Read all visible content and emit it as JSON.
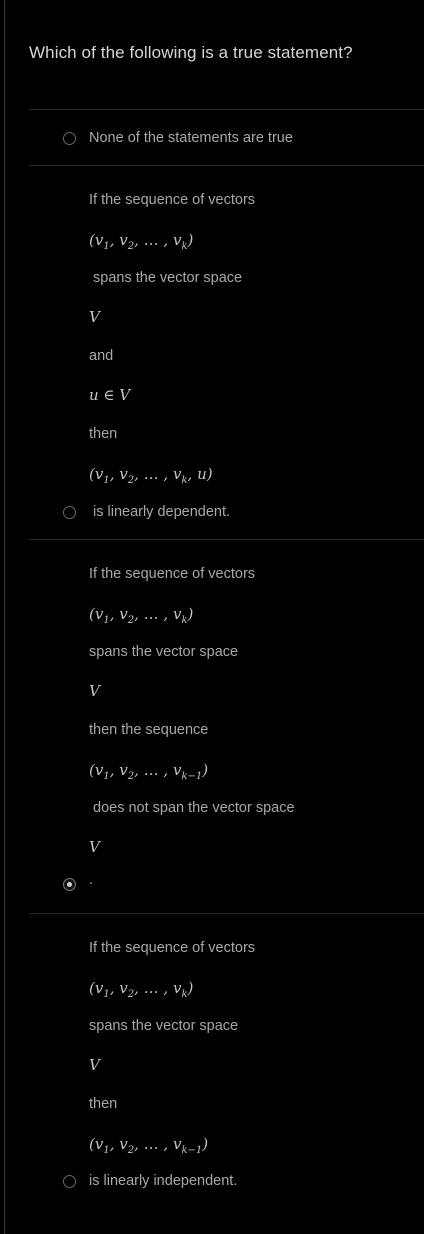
{
  "question": "Which of the following is a true statement?",
  "options": [
    {
      "selected": false,
      "text": "None of the statements are true"
    },
    {
      "selected": false,
      "lines": [
        "If the sequence of vectors",
        "(v1, v2, … , vk)",
        "spans the vector space",
        "V",
        "and",
        "u ∈ V",
        "then",
        "(v1, v2, … , vk, u)",
        "is linearly dependent."
      ]
    },
    {
      "selected": true,
      "lines": [
        "If the sequence of vectors",
        "(v1, v2, … , vk)",
        "spans the vector space",
        "V",
        "then the sequence",
        "(v1, v2, … , vk−1)",
        "does not span the vector space",
        "V",
        "."
      ]
    },
    {
      "selected": false,
      "lines": [
        "If the sequence of vectors",
        "(v1, v2, … , vk)",
        "spans the vector space",
        "V",
        "then",
        "(v1, v2, … , vk−1)",
        "is linearly independent."
      ]
    }
  ]
}
